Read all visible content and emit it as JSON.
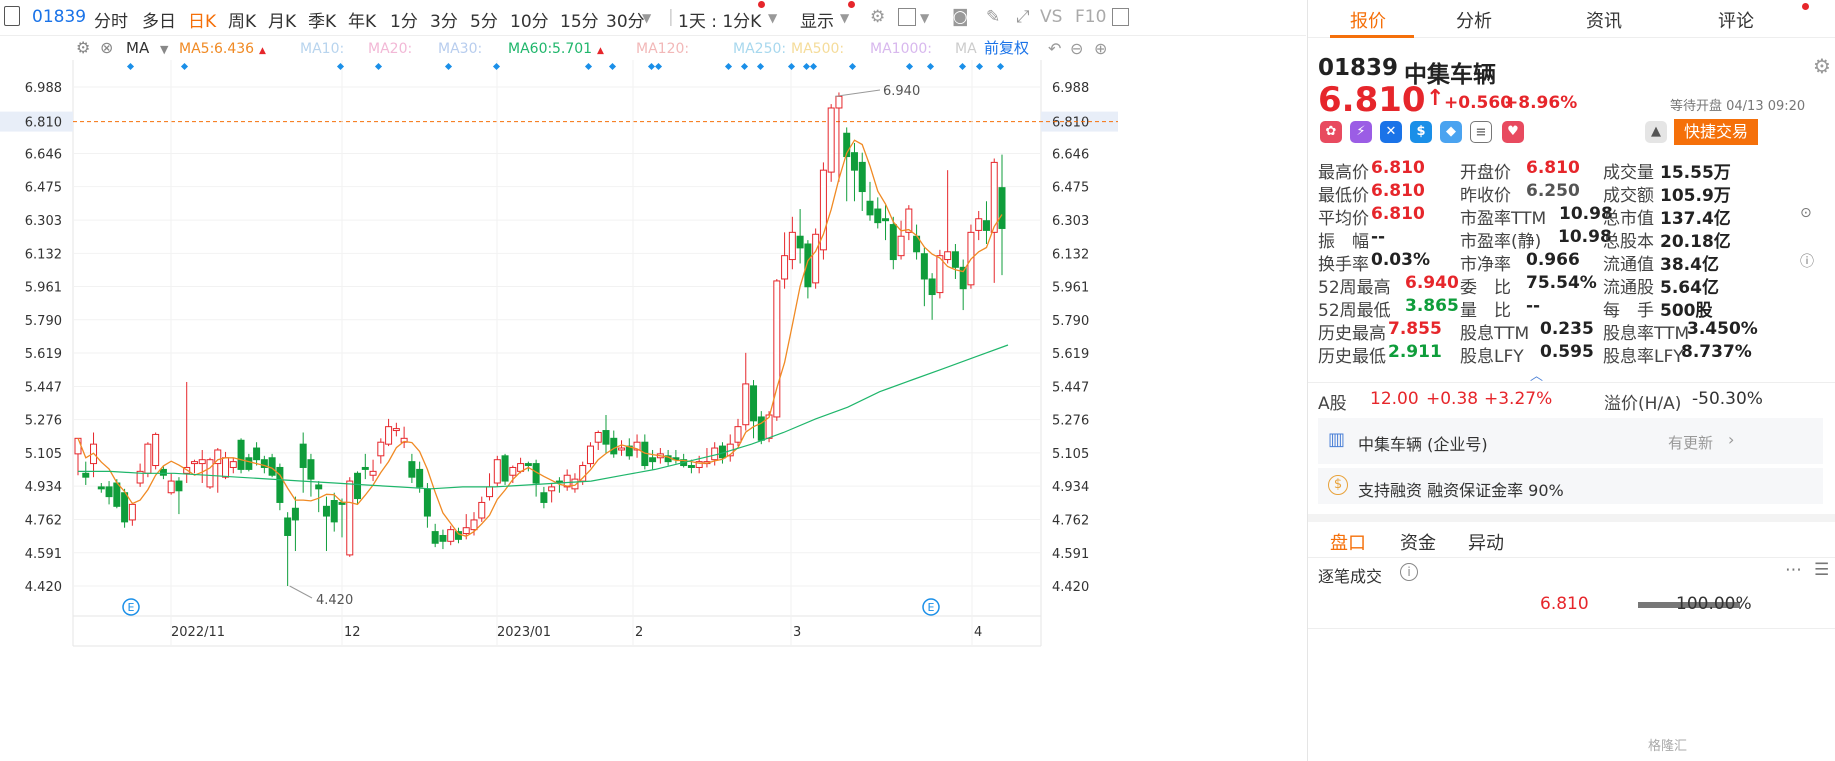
{
  "toolbar": {
    "code": "01839",
    "periods": [
      "分时",
      "多日",
      "日K",
      "周K",
      "月K",
      "季K",
      "年K",
      "1分",
      "3分",
      "5分",
      "10分",
      "15分",
      "30分"
    ],
    "interval_label": "1天 : 1分K",
    "display_label": "显示",
    "vs_label": "VS",
    "f10_label": "F10"
  },
  "ma_bar": {
    "type": "MA",
    "items": [
      {
        "label": "MA5:",
        "value": "6.436",
        "color": "#f08a24"
      },
      {
        "label": "MA10:",
        "value": "",
        "color": "#b8d4ee"
      },
      {
        "label": "MA20:",
        "value": "",
        "color": "#f2b8d6"
      },
      {
        "label": "MA30:",
        "value": "",
        "color": "#b8cdee"
      },
      {
        "label": "MA60:",
        "value": "5.701",
        "color": "#1fb66b"
      },
      {
        "label": "MA120:",
        "value": "",
        "color": "#f2b8b8"
      },
      {
        "label": "MA250:",
        "value": "",
        "color": "#a8d8ee"
      },
      {
        "label": "MA500:",
        "value": "",
        "color": "#f5dc9a"
      },
      {
        "label": "MA1000:",
        "value": "",
        "color": "#d8b8ee"
      },
      {
        "label": "MA",
        "value": "",
        "color": "#ccc"
      }
    ],
    "adjust_label": "前复权"
  },
  "chart_data": {
    "type": "candlestick",
    "y_ticks": [
      "6.988",
      "6.810",
      "6.646",
      "6.475",
      "6.303",
      "6.132",
      "5.961",
      "5.790",
      "5.619",
      "5.447",
      "5.276",
      "5.105",
      "4.934",
      "4.762",
      "4.591",
      "4.420"
    ],
    "x_labels": [
      "2022/11",
      "12",
      "2023/01",
      "2",
      "3",
      "4"
    ],
    "current_price": "6.810",
    "high_label": "6.940",
    "low_label": "4.420",
    "ylim": [
      4.28,
      7.15
    ],
    "series": [
      {
        "name": "MA5",
        "color": "#f08a24"
      },
      {
        "name": "MA60",
        "color": "#1fb66b"
      }
    ]
  },
  "stock": {
    "code": "01839",
    "name": "中集车辆",
    "price": "6.810",
    "change": "+0.560",
    "change_pct": "+8.96%",
    "status": "等待开盘 04/13 09:20",
    "quick_trade": "快捷交易"
  },
  "tabs": [
    "报价",
    "分析",
    "资讯",
    "评论"
  ],
  "quote": [
    [
      {
        "l": "最高价",
        "v": "6.810",
        "c": "red"
      },
      {
        "l": "开盘价",
        "v": "6.810",
        "c": "red"
      },
      {
        "l": "成交量",
        "v": "15.55万",
        "c": "blk"
      }
    ],
    [
      {
        "l": "最低价",
        "v": "6.810",
        "c": "red"
      },
      {
        "l": "昨收价",
        "v": "6.250",
        "c": "gry"
      },
      {
        "l": "成交额",
        "v": "105.9万",
        "c": "blk"
      }
    ],
    [
      {
        "l": "平均价",
        "v": "6.810",
        "c": "red"
      },
      {
        "l": "市盈率TTM",
        "v": "10.98",
        "c": "blk"
      },
      {
        "l": "总市值",
        "v": "137.4亿",
        "c": "blk"
      }
    ],
    [
      {
        "l": "振　幅",
        "v": "--",
        "c": "blk"
      },
      {
        "l": "市盈率(静)",
        "v": "10.98",
        "c": "blk"
      },
      {
        "l": "总股本",
        "v": "20.18亿",
        "c": "blk"
      }
    ],
    [
      {
        "l": "换手率",
        "v": "0.03%",
        "c": "blk"
      },
      {
        "l": "市净率",
        "v": "0.966",
        "c": "blk"
      },
      {
        "l": "流通值",
        "v": "38.4亿",
        "c": "blk"
      }
    ],
    [
      {
        "l": "52周最高",
        "v": "6.940",
        "c": "red"
      },
      {
        "l": "委　比",
        "v": "75.54%",
        "c": "blk"
      },
      {
        "l": "流通股",
        "v": "5.64亿",
        "c": "blk"
      }
    ],
    [
      {
        "l": "52周最低",
        "v": "3.865",
        "c": "grn"
      },
      {
        "l": "量　比",
        "v": "--",
        "c": "blk"
      },
      {
        "l": "每　手",
        "v": "500股",
        "c": "blk"
      }
    ],
    [
      {
        "l": "历史最高",
        "v": "7.855",
        "c": "red"
      },
      {
        "l": "股息TTM",
        "v": "0.235",
        "c": "blk"
      },
      {
        "l": "股息率TTM",
        "v": "3.450%",
        "c": "blk"
      }
    ],
    [
      {
        "l": "历史最低",
        "v": "2.911",
        "c": "grn"
      },
      {
        "l": "股息LFY",
        "v": "0.595",
        "c": "blk"
      },
      {
        "l": "股息率LFY",
        "v": "8.737%",
        "c": "blk"
      }
    ]
  ],
  "a_share": {
    "label": "A股",
    "price": "12.00",
    "change": "+0.38",
    "change_pct": "+3.27%",
    "premium_label": "溢价(H/A)",
    "premium": "-50.30%"
  },
  "enterprise": {
    "name": "中集车辆 (企业号)",
    "update": "有更新"
  },
  "margin": "支持融资 融资保证金率 90%",
  "bottom_tabs": [
    "盘口",
    "资金",
    "异动"
  ],
  "trades": {
    "title": "逐笔成交",
    "price": "6.810",
    "pct": "100.00%"
  },
  "watermark": "格隆汇"
}
